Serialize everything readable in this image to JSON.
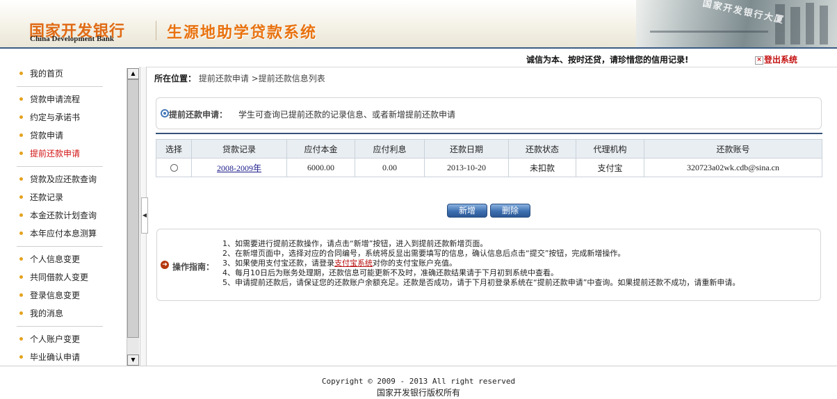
{
  "header": {
    "bank_cn": "国家开发银行",
    "bank_en": "China Development Bank",
    "system_title": "生源地助学贷款系统",
    "building_sign": "国家开发银行大厦",
    "slogan": "诚信为本、按时还贷，请珍惜您的信用记录!",
    "logout_label": "登出系统"
  },
  "sidebar": {
    "items": [
      {
        "label": "我的首页"
      },
      {
        "label": "贷款申请流程"
      },
      {
        "label": "约定与承诺书"
      },
      {
        "label": "贷款申请"
      },
      {
        "label": "提前还款申请",
        "active": true
      },
      {
        "label": "贷款及应还款查询"
      },
      {
        "label": "还款记录"
      },
      {
        "label": "本金还款计划查询"
      },
      {
        "label": "本年应付本息测算"
      },
      {
        "label": "个人信息变更"
      },
      {
        "label": "共同借款人变更"
      },
      {
        "label": "登录信息变更"
      },
      {
        "label": "我的消息"
      },
      {
        "label": "个人账户变更"
      },
      {
        "label": "毕业确认申请"
      }
    ]
  },
  "breadcrumb": {
    "prefix": "所在位置：",
    "path": "提前还款申请 >提前还款信息列表"
  },
  "intro": {
    "label": "提前还款申请：",
    "text": "学生可查询已提前还款的记录信息、或者新增提前还款申请"
  },
  "table": {
    "headers": [
      "选择",
      "贷款记录",
      "应付本金",
      "应付利息",
      "还款日期",
      "还款状态",
      "代理机构",
      "还款账号"
    ],
    "rows": [
      {
        "loan_record": "2008-2009年",
        "principal": "6000.00",
        "interest": "0.00",
        "date": "2013-10-20",
        "status": "未扣款",
        "agency": "支付宝",
        "account": "320723a02wk.cdb@sina.cn"
      }
    ]
  },
  "buttons": {
    "add": "新增",
    "delete": "删除"
  },
  "guide": {
    "label": "操作指南：",
    "line1": "1、如需要进行提前还款操作，请点击“新增”按钮，进入到提前还款新增页面。",
    "line2": "2、在新增页面中，选择对应的合同编号，系统将反显出需要填写的信息，确认信息后点击“提交”按钮，完成新增操作。",
    "line3_pre": "3、如果使用支付宝还款，请登录",
    "line3_link": "支付宝系统",
    "line3_post": "对你的支付宝账户充值。",
    "line4": "4、每月10日后为账务处理期，还款信息可能更新不及时，准确还款结果请于下月初到系统中查看。",
    "line5": "5、申请提前还款后，请保证您的还款账户余额充足。还款是否成功，请于下月初登录系统在“提前还款申请”中查询。如果提前还款不成功，请重新申请。"
  },
  "footer": {
    "copyright": "Copyright © 2009 - 2013 All right reserved",
    "owner": "国家开发银行版权所有"
  }
}
